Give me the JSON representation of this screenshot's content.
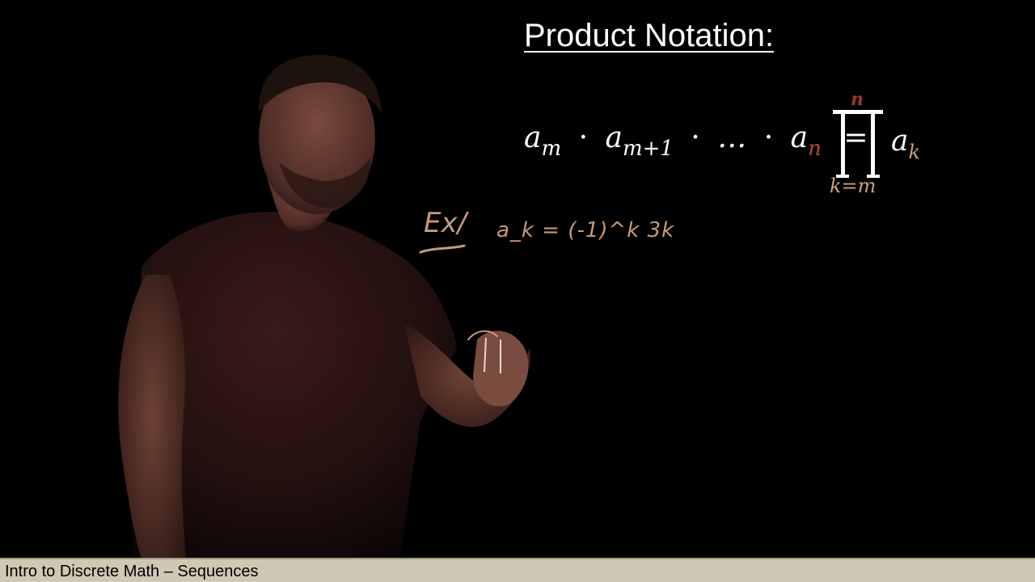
{
  "slide": {
    "title": "Product Notation:",
    "formula": {
      "lhs_term1_base": "a",
      "lhs_term1_sub": "m",
      "lhs_term2_base": "a",
      "lhs_term2_sub": "m+1",
      "lhs_ellipsis": "…",
      "lhs_term3_base": "a",
      "lhs_term3_sub": "n",
      "equals": "=",
      "product_upper": "n",
      "product_lower": "k=m",
      "product_term_base": "a",
      "product_term_sub": "k",
      "product_symbol": "∏"
    },
    "handwriting": {
      "example_label": "Ex/",
      "example_formula": "a_k = (-1)^k 3k"
    }
  },
  "footer": {
    "text": "Intro to Discrete Math – Sequences"
  },
  "colors": {
    "background": "#000000",
    "accent_red": "#b5473a",
    "accent_tan": "#c9a27e",
    "handwriting": "#c79878",
    "footer_bg": "#cfc8b4"
  }
}
